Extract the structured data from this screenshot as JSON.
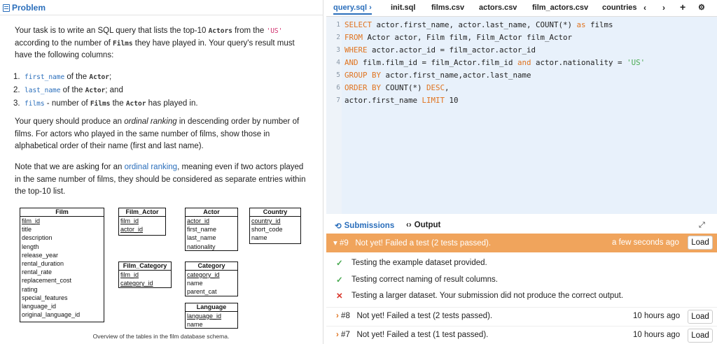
{
  "problem": {
    "tab_label": "Problem",
    "p1_a": "Your task is to write an SQL query that lists the top-10 ",
    "p1_actors": "Actors",
    "p1_b": " from the ",
    "p1_us": "'US'",
    "p1_c": " according to the number of ",
    "p1_films": "Films",
    "p1_d": " they have played in. Your query's result must have the following columns:",
    "req": [
      {
        "n": "1.",
        "code": "first_name",
        "mid": " of the ",
        "tbl": "Actor",
        "end": ";"
      },
      {
        "n": "2.",
        "code": "last_name",
        "mid": " of the ",
        "tbl": "Actor",
        "end": "; and"
      },
      {
        "n": "3.",
        "code": "films",
        "mid": " - number of ",
        "tbl": "Films",
        "mid2": " the ",
        "tbl2": "Actor",
        "end": " has played in."
      }
    ],
    "p2_a": "Your query should produce an ",
    "p2_em": "ordinal ranking",
    "p2_b": " in descending order by number of films. For actors who played in the same number of films, show those in alphabetical order of their name (first and last name).",
    "p3_a": "Note that we are asking for an ",
    "p3_link": "ordinal ranking",
    "p3_b": ", meaning even if two actors played in the same number of films, they should be considered as separate entries within the top-10 list.",
    "caption": "Overview of the tables in the film database schema."
  },
  "schema": {
    "film": {
      "name": "Film",
      "cols": [
        "film_id",
        "title",
        "description",
        "length",
        "release_year",
        "rental_duration",
        "rental_rate",
        "replacement_cost",
        "rating",
        "special_features",
        "language_id",
        "original_language_id"
      ]
    },
    "film_actor": {
      "name": "Film_Actor",
      "cols": [
        "film_id",
        "actor_id"
      ]
    },
    "actor": {
      "name": "Actor",
      "cols": [
        "actor_id",
        "first_name",
        "last_name",
        "nationality"
      ]
    },
    "country": {
      "name": "Country",
      "cols": [
        "country_id",
        "short_code",
        "name"
      ]
    },
    "film_category": {
      "name": "Film_Category",
      "cols": [
        "film_id",
        "category_id"
      ]
    },
    "category": {
      "name": "Category",
      "cols": [
        "category_id",
        "name",
        "parent_cat"
      ]
    },
    "language": {
      "name": "Language",
      "cols": [
        "language_id",
        "name"
      ]
    }
  },
  "tabs": [
    "query.sql",
    "init.sql",
    "films.csv",
    "actors.csv",
    "film_actors.csv",
    "countries"
  ],
  "tab_controls": {
    "prev": "‹",
    "next": "›",
    "add": "+",
    "settings": "⚙"
  },
  "editor": {
    "lines": [
      {
        "n": "1",
        "parts": [
          [
            "kw",
            "SELECT"
          ],
          [
            "fn",
            " actor.first_name, actor.last_name, COUNT(*) "
          ],
          [
            "kw",
            "as"
          ],
          [
            "fn",
            " films"
          ]
        ]
      },
      {
        "n": "2",
        "parts": [
          [
            "kw",
            "FROM"
          ],
          [
            "fn",
            " Actor actor, Film film, Film_Actor film_Actor"
          ]
        ]
      },
      {
        "n": "3",
        "parts": [
          [
            "kw",
            "WHERE"
          ],
          [
            "fn",
            " actor.actor_id = film_actor.actor_id"
          ]
        ]
      },
      {
        "n": "4",
        "parts": [
          [
            "kw",
            "AND"
          ],
          [
            "fn",
            " film.film_id = film_Actor.film_id "
          ],
          [
            "kw",
            "and"
          ],
          [
            "fn",
            " actor.nationality = "
          ],
          [
            "st",
            "'US'"
          ]
        ]
      },
      {
        "n": "5",
        "parts": [
          [
            "kw",
            "GROUP BY"
          ],
          [
            "fn",
            " actor.first_name,actor.last_name"
          ]
        ]
      },
      {
        "n": "6",
        "parts": [
          [
            "kw",
            "ORDER BY"
          ],
          [
            "fn",
            " COUNT(*) "
          ],
          [
            "kw",
            "DESC"
          ],
          [
            "fn",
            ","
          ]
        ]
      },
      {
        "n": "7",
        "parts": [
          [
            "fn",
            "actor.first_name "
          ],
          [
            "kw",
            "LIMIT"
          ],
          [
            "fn",
            " 10"
          ]
        ]
      }
    ]
  },
  "submissions": {
    "tab_label": "Submissions",
    "output_label": "Output",
    "latest": {
      "num": "#9",
      "status": "Not yet! Failed a test (2 tests passed).",
      "time": "a few seconds ago",
      "load": "Load"
    },
    "tests": [
      {
        "ok": true,
        "text": "Testing the example dataset provided."
      },
      {
        "ok": true,
        "text": "Testing correct naming of result columns."
      },
      {
        "ok": false,
        "text": "Testing a larger dataset. Your submission did not produce the correct output."
      }
    ],
    "older": [
      {
        "num": "#8",
        "status": "Not yet! Failed a test (2 tests passed).",
        "time": "10 hours ago",
        "load": "Load"
      },
      {
        "num": "#7",
        "status": "Not yet! Failed a test (1 test passed).",
        "time": "10 hours ago",
        "load": "Load"
      }
    ]
  },
  "colors": {
    "accent": "#2a6ebb",
    "keyword": "#e0731e",
    "string": "#4aaa52",
    "fail_banner": "#f0a45c",
    "error": "#d9362b"
  }
}
